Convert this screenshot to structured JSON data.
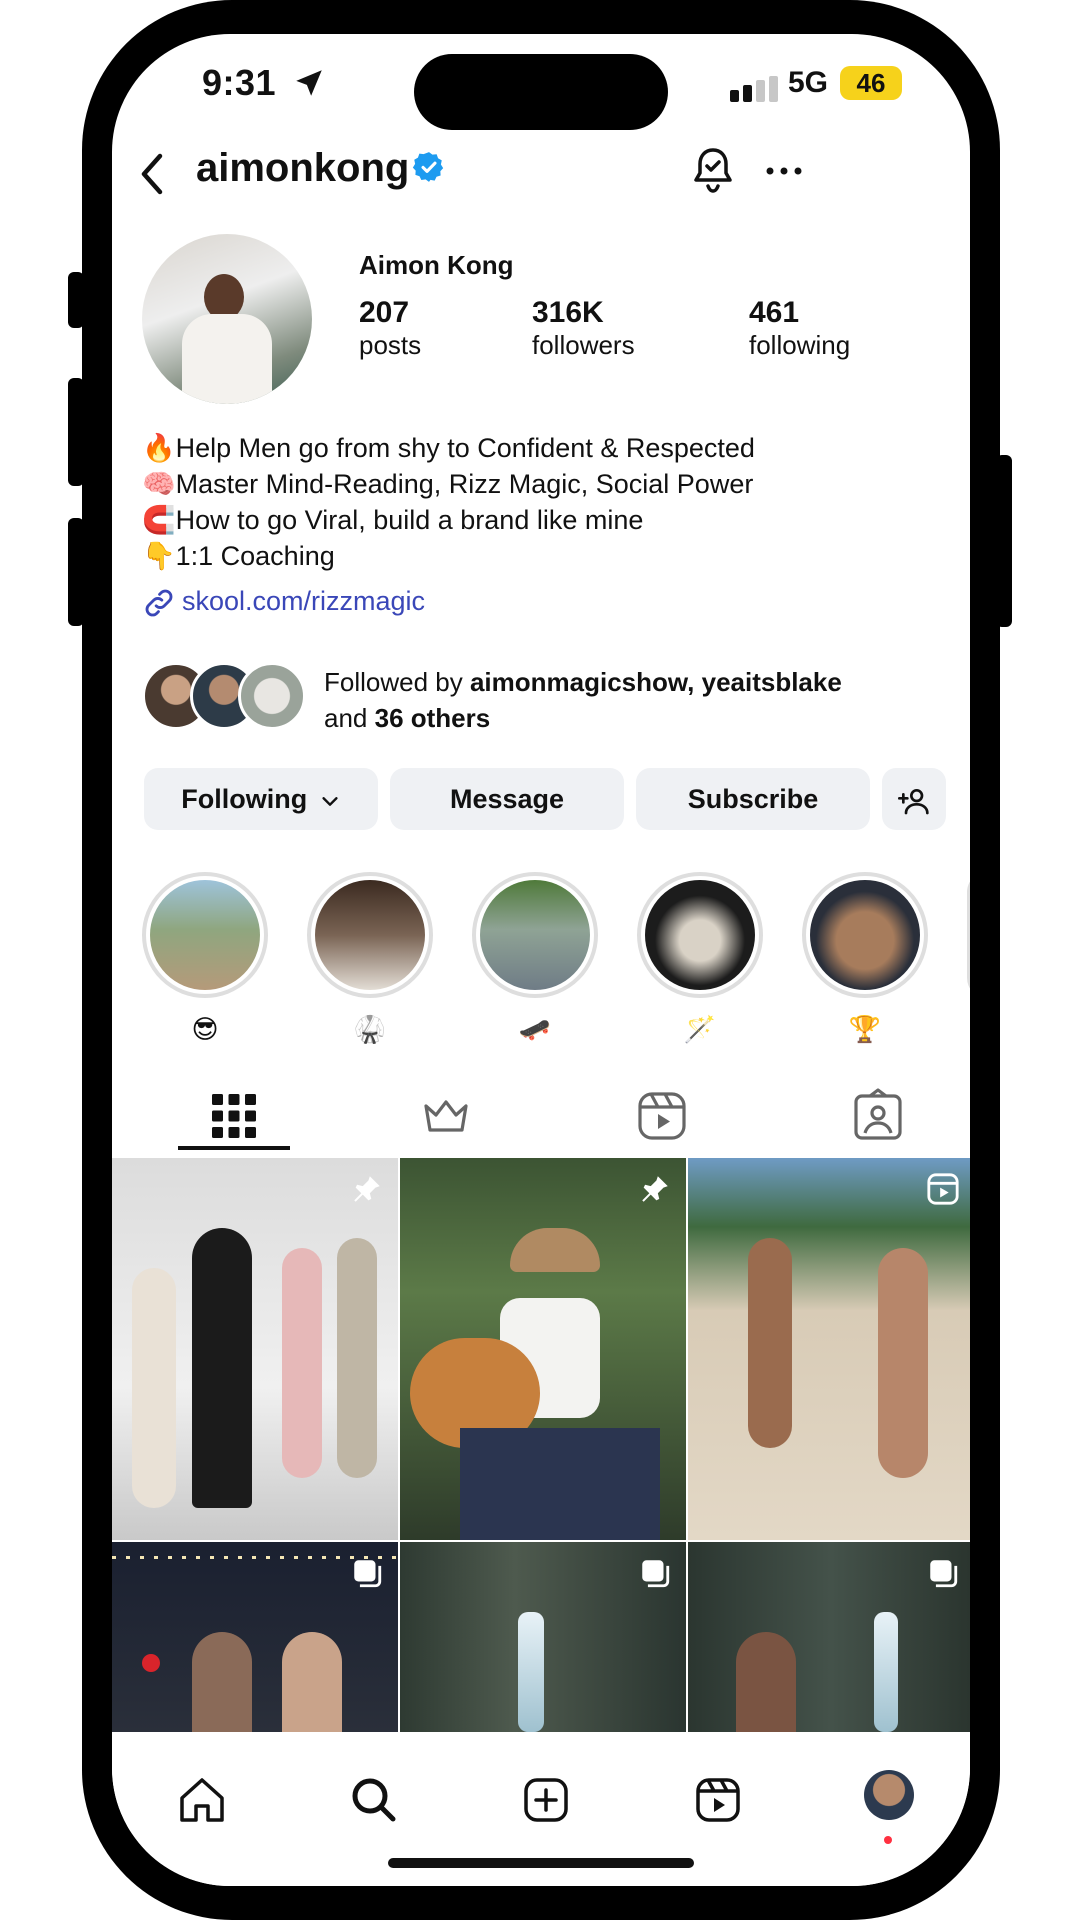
{
  "status": {
    "time": "9:31",
    "network": "5G",
    "battery": "46"
  },
  "header": {
    "username": "aimonkong",
    "back_icon": "back-arrow-icon",
    "bell_icon": "notification-bell-icon",
    "more_icon": "more-dots-icon"
  },
  "profile": {
    "full_name": "Aimon Kong",
    "stats": [
      {
        "value": "207",
        "label": "posts"
      },
      {
        "value": "316K",
        "label": "followers"
      },
      {
        "value": "461",
        "label": "following"
      }
    ],
    "bio": [
      "🔥Help Men go from shy to Confident & Respected",
      "🧠Master Mind-Reading, Rizz Magic, Social Power",
      "🧲How to go Viral, build a brand like mine",
      "👇1:1 Coaching"
    ],
    "link": "skool.com/rizzmagic",
    "followed_by": {
      "prefix": "Followed by ",
      "names": "aimonmagicshow, yeaitsblake",
      "and": "and ",
      "others": "36 others"
    }
  },
  "actions": {
    "following": "Following",
    "message": "Message",
    "subscribe": "Subscribe"
  },
  "highlights": [
    {
      "label": "😎"
    },
    {
      "label": "🥋"
    },
    {
      "label": "🛹"
    },
    {
      "label": "🪄"
    },
    {
      "label": "🏆"
    }
  ],
  "colors": {
    "accent_link": "#3a47b8",
    "button_bg": "#eff1f4",
    "battery": "#f6d21b",
    "verified": "#1d9bf0",
    "notification_dot": "#ff3040"
  }
}
